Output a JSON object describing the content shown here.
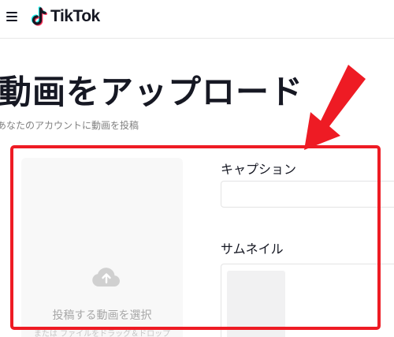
{
  "header": {
    "logo_text": "TikTok",
    "menu_icon": "hamburger-menu-icon",
    "logo_icon": "tiktok-note-icon"
  },
  "main": {
    "title": "動画をアップロード",
    "subtitle": "あなたのアカウントに動画を投稿"
  },
  "upload": {
    "icon": "cloud-upload-icon",
    "label": "投稿する動画を選択",
    "sublabel": "または ファイルをドラッグ＆ドロップ"
  },
  "form": {
    "caption_label": "キャプション",
    "caption_value": "",
    "thumbnail_label": "サムネイル"
  },
  "annotation": {
    "color": "#ee1b24",
    "arrow_icon": "red-arrow-icon"
  },
  "colors": {
    "text": "#161823",
    "muted": "#a7a7a7",
    "tiktok_cyan": "#25f4ee",
    "tiktok_red": "#fe2c55"
  }
}
